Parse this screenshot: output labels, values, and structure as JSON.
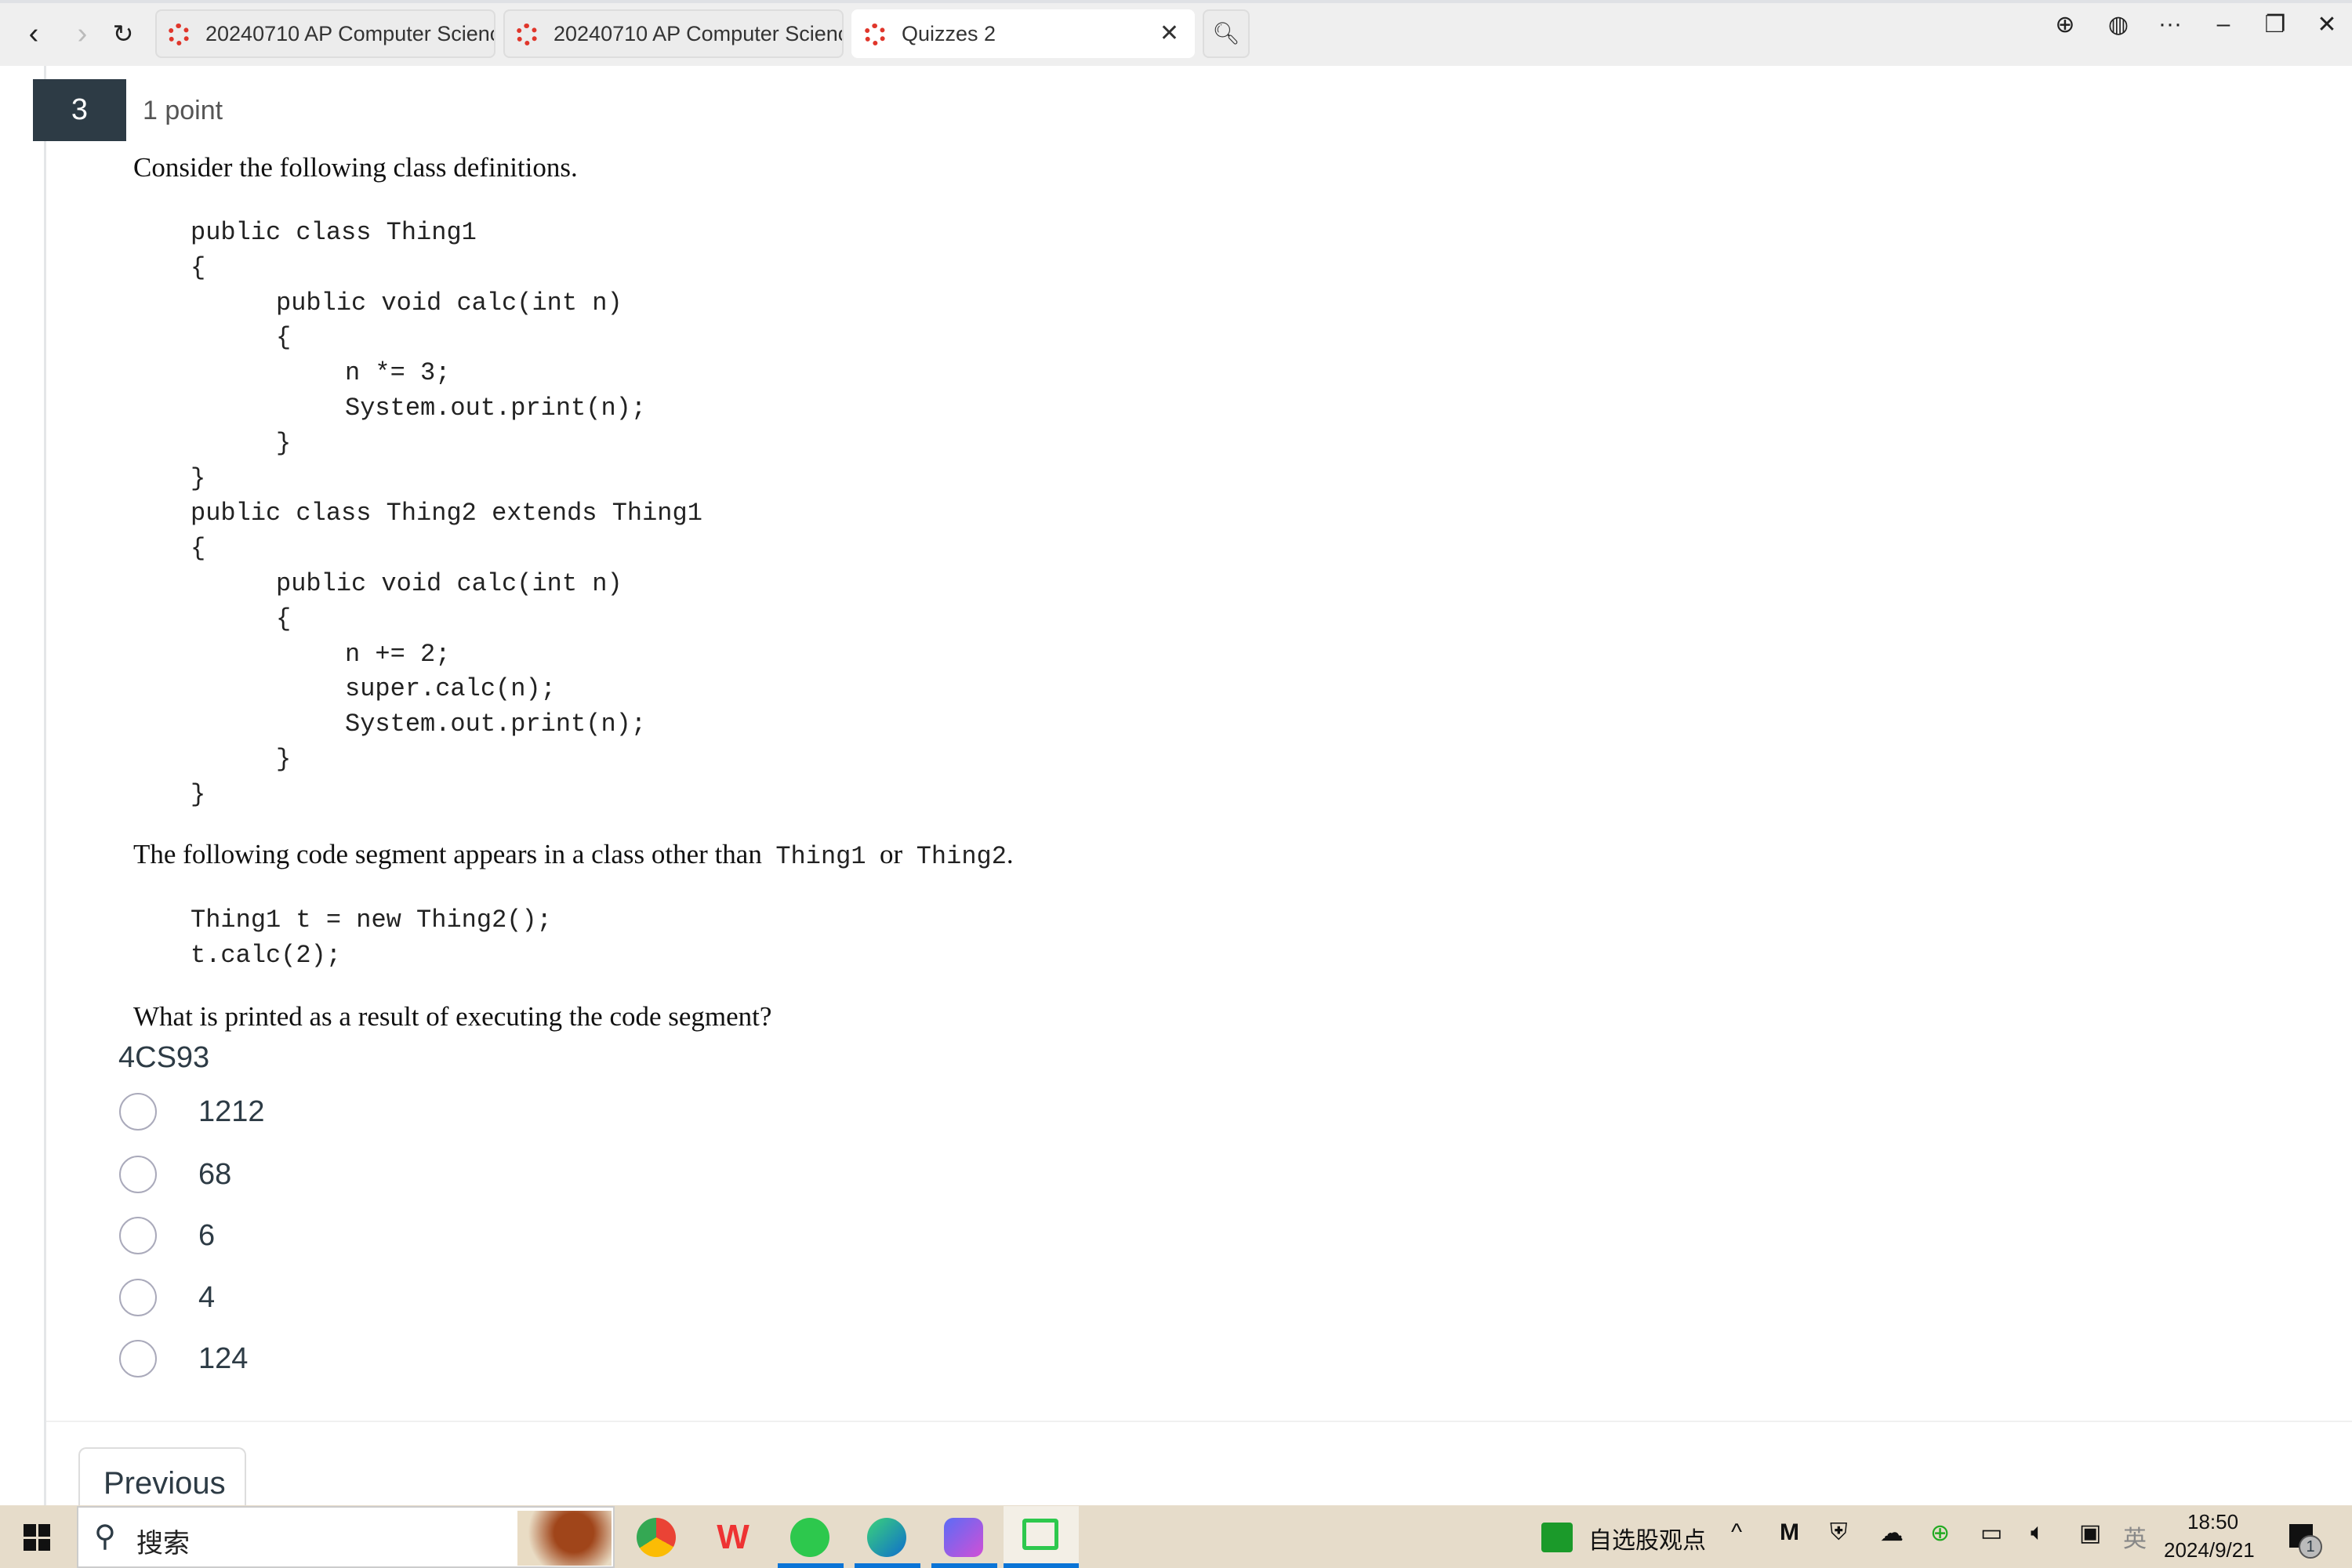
{
  "browser": {
    "tabs": [
      {
        "title": "20240710 AP Computer Science",
        "active": false
      },
      {
        "title": "20240710 AP Computer Science",
        "active": false
      },
      {
        "title": "Quizzes 2",
        "active": true
      }
    ],
    "tab_icon": "canvas-logo-icon",
    "accent": "#e0362b"
  },
  "question": {
    "number": "3",
    "points": "1 point",
    "intro": "Consider the following class definitions.",
    "code1": [
      {
        "indent": 0,
        "text": "public class Thing1"
      },
      {
        "indent": 0,
        "text": "{"
      },
      {
        "indent": 1,
        "text": "public void calc(int n)"
      },
      {
        "indent": 1,
        "text": "{"
      },
      {
        "indent": 2,
        "text": "n *= 3;"
      },
      {
        "indent": 2,
        "text": "System.out.print(n);"
      },
      {
        "indent": 1,
        "text": "}"
      },
      {
        "indent": 0,
        "text": "}"
      },
      {
        "indent": 0,
        "text": "public class Thing2 extends Thing1"
      },
      {
        "indent": 0,
        "text": "{"
      },
      {
        "indent": 1,
        "text": "public void calc(int n)"
      },
      {
        "indent": 1,
        "text": "{"
      },
      {
        "indent": 2,
        "text": "n += 2;"
      },
      {
        "indent": 2,
        "text": "super.calc(n);"
      },
      {
        "indent": 2,
        "text": "System.out.print(n);"
      },
      {
        "indent": 1,
        "text": "}"
      },
      {
        "indent": 0,
        "text": "}"
      }
    ],
    "segment_pre": "The following code segment appears in a class other than",
    "segment_code_a": "Thing1",
    "segment_or": "or",
    "segment_code_b": "Thing2",
    "segment_end": ".",
    "code2": [
      "Thing1 t = new Thing2();",
      "t.calc(2);"
    ],
    "prompt": "What is printed as a result of executing the code segment?",
    "tag": "4CS93",
    "options": [
      "1212",
      "68",
      "6",
      "4",
      "124"
    ],
    "selected": null
  },
  "nav": {
    "previous": "Previous"
  },
  "taskbar": {
    "search_placeholder": "搜索",
    "news": "自选股观点",
    "ime": "英",
    "time": "18:50",
    "date": "2024/9/21",
    "notifications": "1"
  }
}
